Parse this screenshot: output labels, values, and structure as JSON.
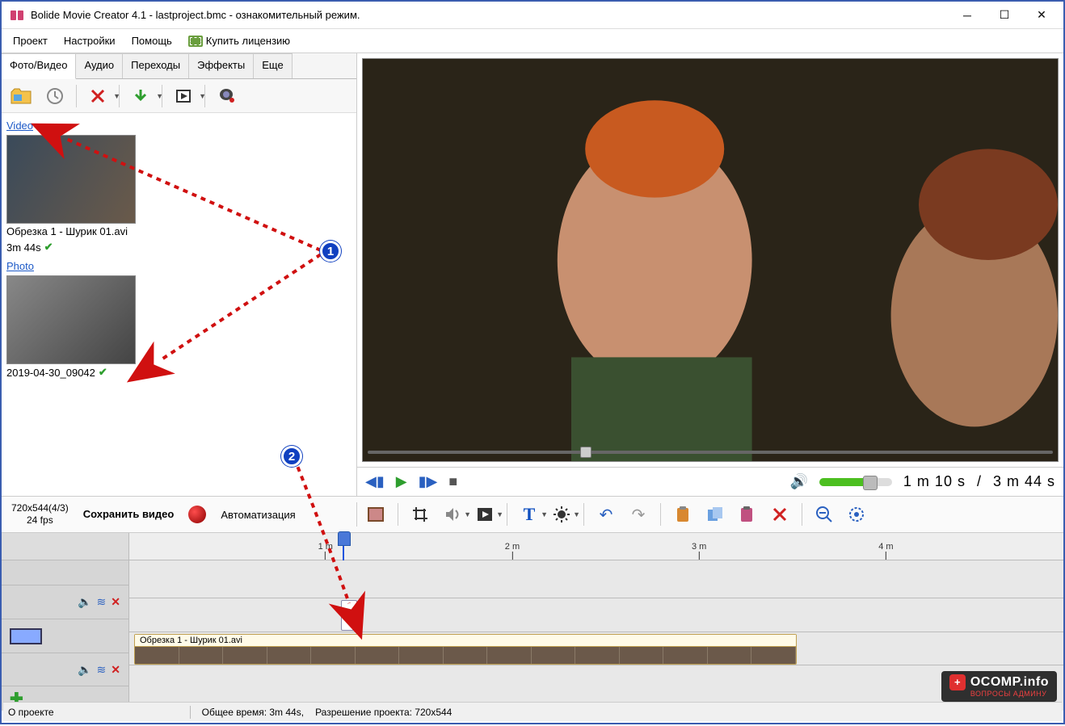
{
  "window": {
    "title": "Bolide Movie Creator 4.1 - lastproject.bmc  - ознакомительный режим."
  },
  "menu": {
    "project": "Проект",
    "settings": "Настройки",
    "help": "Помощь",
    "buy": "Купить лицензию"
  },
  "tabs": {
    "photo_video": "Фото/Видео",
    "audio": "Аудио",
    "transitions": "Переходы",
    "effects": "Эффекты",
    "more": "Еще"
  },
  "media": {
    "video_section": "Video",
    "video1_name": "Обрезка 1 - Шурик 01.avi",
    "video1_duration": "3m 44s",
    "photo_section": "Photo",
    "photo1_name": "2019-04-30_09042"
  },
  "project_info": {
    "resolution_line": "720x544(4/3)",
    "fps_line": "24 fps",
    "save_label": "Сохранить видео",
    "automation_label": "Автоматизация"
  },
  "playback": {
    "current": "1 m 10 s",
    "separator": "/",
    "total": "3 m 44 s"
  },
  "timeline": {
    "ticks": [
      "1 m",
      "2 m",
      "3 m",
      "4 m"
    ],
    "clip_label": "Обрезка 1 - Шурик 01.avi"
  },
  "status": {
    "about": "О проекте",
    "total_time": "Общее время: 3m 44s,",
    "resolution": "Разрешение проекта:   720x544"
  },
  "annotations": {
    "marker1": "1",
    "marker2": "2"
  },
  "watermark": {
    "brand": "OCOMP.info",
    "sub": "ВОПРОСЫ АДМИНУ"
  }
}
